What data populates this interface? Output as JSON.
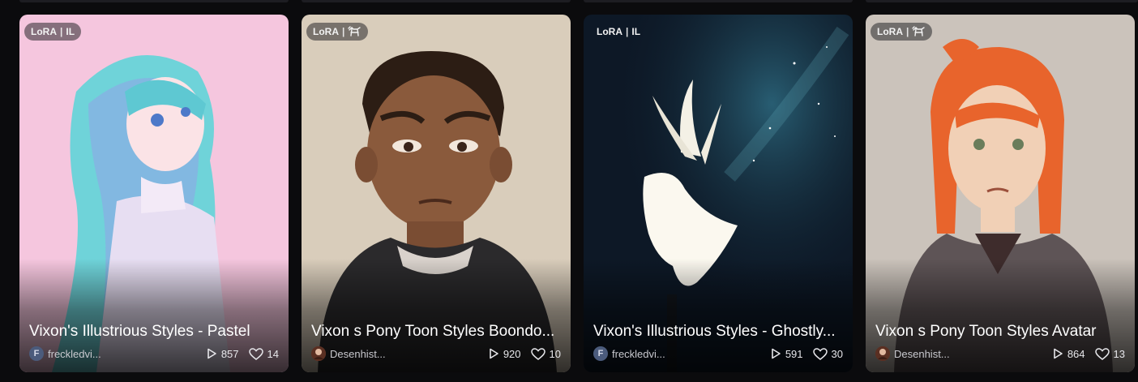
{
  "cards": [
    {
      "badge_type": "LoRA",
      "badge_base": "IL",
      "title": "Vixon's Illustrious Styles - Pastel",
      "avatar_letter": "F",
      "author": "freckledvi...",
      "downloads": "857",
      "likes": "14"
    },
    {
      "badge_type": "LoRA",
      "badge_base_icon": "pony-icon",
      "title": "Vixon s Pony Toon Styles Boondo...",
      "author": "Desenhist...",
      "downloads": "920",
      "likes": "10"
    },
    {
      "badge_type": "LoRA",
      "badge_base": "IL",
      "title": "Vixon's Illustrious Styles - Ghostly...",
      "avatar_letter": "F",
      "author": "freckledvi...",
      "downloads": "591",
      "likes": "30"
    },
    {
      "badge_type": "LoRA",
      "badge_base_icon": "pony-icon",
      "title": "Vixon s Pony Toon Styles Avatar",
      "author": "Desenhist...",
      "downloads": "864",
      "likes": "13"
    }
  ],
  "icons": {
    "downloads": "play-icon",
    "likes": "heart-icon"
  },
  "colors": {
    "page_background": "#0b0b0d",
    "card1_background": "#f5c6de",
    "card2_background": "#d9cdbb",
    "card3_background": "#0d1826",
    "card4_background": "#cbc3bb"
  }
}
